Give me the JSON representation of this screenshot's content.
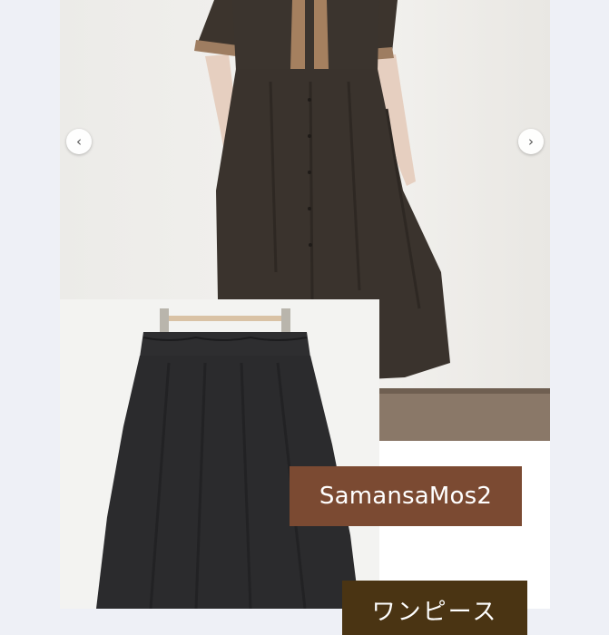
{
  "gallery": {
    "prev_icon": "chevron-left-icon",
    "next_icon": "chevron-right-icon",
    "prev_glyph": "‹",
    "next_glyph": "›"
  },
  "labels": {
    "brand": "SamansaMos2",
    "type": "ワンピース"
  },
  "colors": {
    "brand_label_bg": "#7b4a32",
    "type_label_bg": "#4a3413",
    "dress": "#3a332d",
    "skirt": "#2b2b2d"
  }
}
